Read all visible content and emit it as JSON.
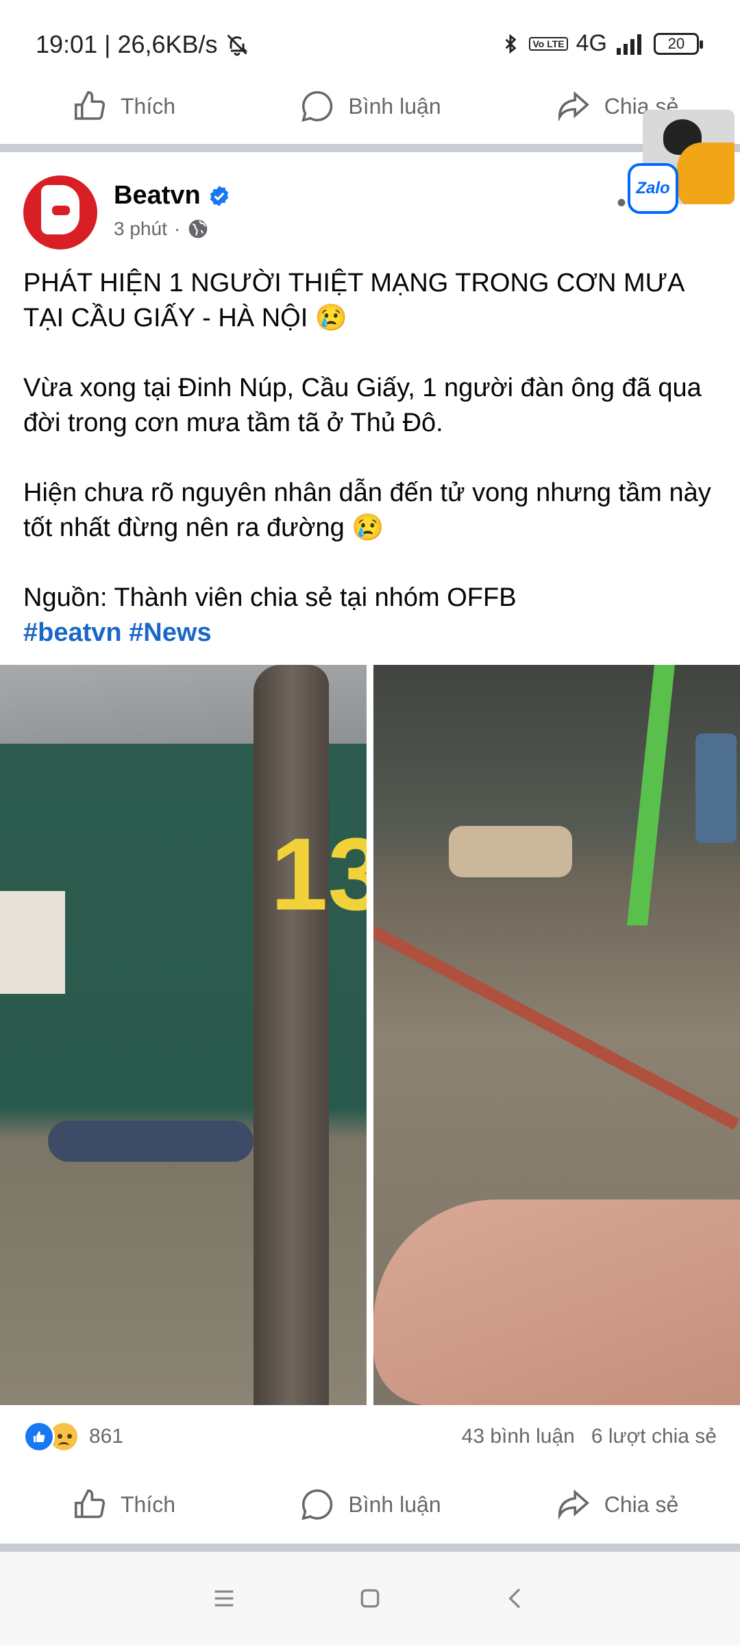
{
  "status_bar": {
    "time_speed": "19:01 | 26,6KB/s",
    "network": "4G",
    "volte": "Vo LTE",
    "battery": "20"
  },
  "action_bar": {
    "like_label": "Thích",
    "comment_label": "Bình luận",
    "share_label": "Chia sẻ"
  },
  "post": {
    "page_name": "Beatvn",
    "time": "3 phút",
    "time_separator": "·",
    "headline": "PHÁT HIỆN 1 NGƯỜI THIỆT MẠNG TRONG CƠN MƯA TẠI CẦU GIẤY - HÀ NỘI 😢",
    "paragraph_1": "Vừa xong tại Đinh Núp, Cầu Giấy, 1 người đàn ông đã qua đời trong cơn mưa tầm tã ở Thủ Đô.",
    "paragraph_2": "Hiện chưa rõ nguyên nhân dẫn đến tử vong nhưng tầm này tốt nhất đừng nên ra đường 😢",
    "source": "Nguồn: Thành viên chia sẻ tại nhóm OFFB",
    "hashtags": "#beatvn #News",
    "photo_number": "13"
  },
  "reactions": {
    "count": "861",
    "comments": "43 bình luận",
    "shares": "6 lượt chia sẻ"
  },
  "floating": {
    "zalo_label": "Zalo"
  },
  "colors": {
    "link": "#1a66c9",
    "secondary_text": "#65676b",
    "verified": "#1877f2",
    "brand_red": "#d81f26"
  }
}
